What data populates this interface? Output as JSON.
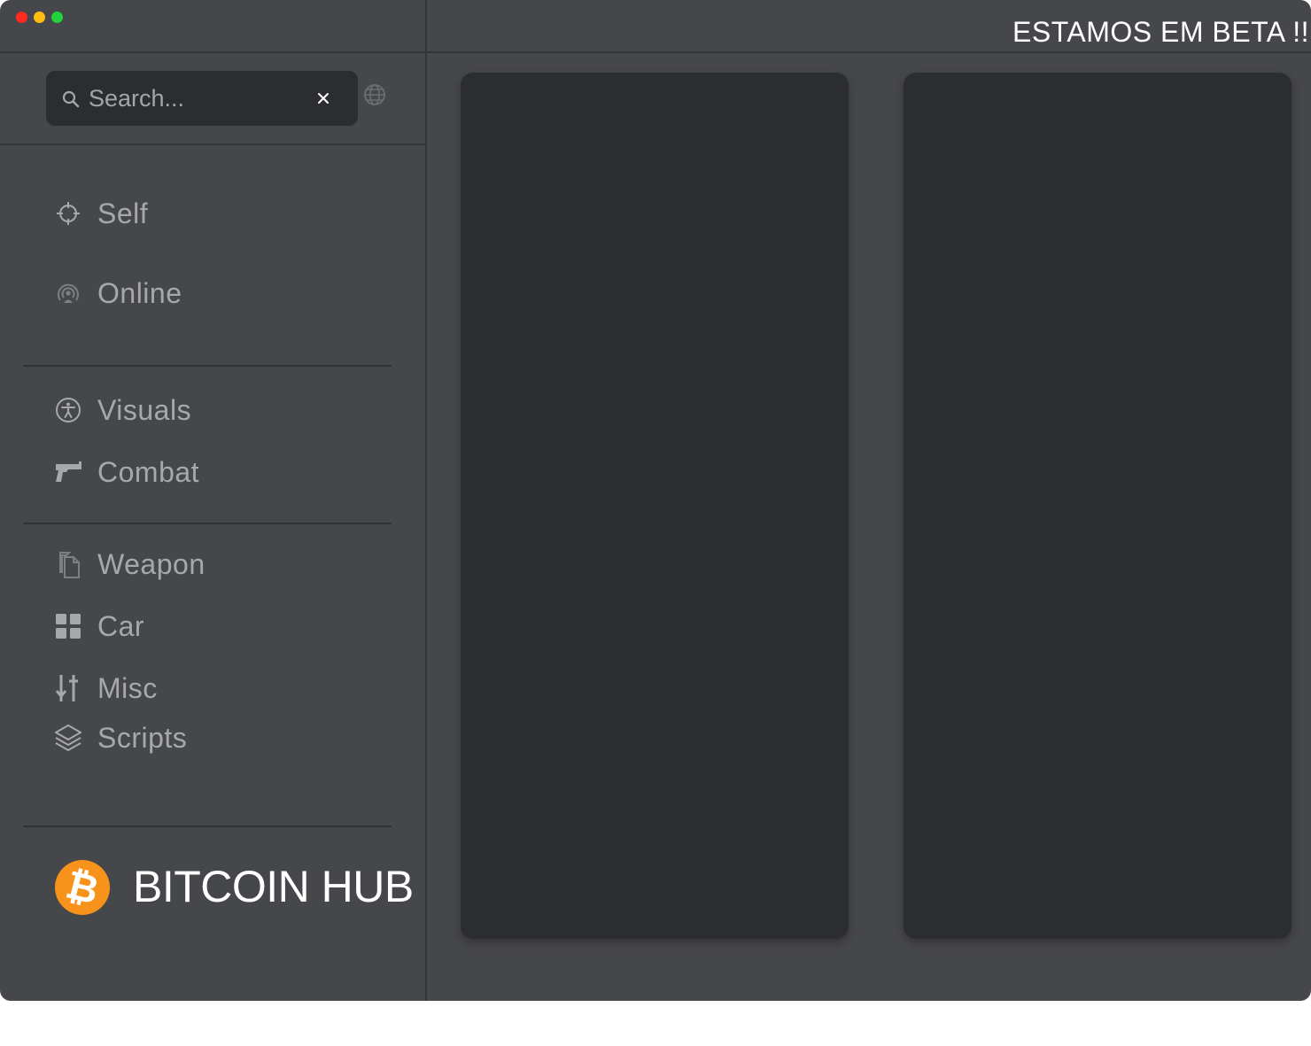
{
  "titlebar": {
    "banner": "ESTAMOS EM BETA !!"
  },
  "search": {
    "placeholder": "Search..."
  },
  "sidebar": {
    "items": [
      {
        "label": "Self",
        "icon": "crosshair-icon"
      },
      {
        "label": "Online",
        "icon": "broadcast-icon"
      },
      {
        "label": "Visuals",
        "icon": "accessibility-icon"
      },
      {
        "label": "Combat",
        "icon": "pistol-icon"
      },
      {
        "label": "Weapon",
        "icon": "copy-icon"
      },
      {
        "label": "Car",
        "icon": "grid-icon"
      },
      {
        "label": "Misc",
        "icon": "sliders-icon"
      },
      {
        "label": "Scripts",
        "icon": "layers-icon"
      }
    ]
  },
  "brand": {
    "name": "BITCOIN HUB",
    "logo_icon": "bitcoin-icon"
  },
  "colors": {
    "window_bg": "#46474a",
    "panel_bg": "#2c2d30",
    "text_muted": "#a6a8ac",
    "bitcoin_orange": "#f7931a",
    "traffic_red": "#ff2a20",
    "traffic_yellow": "#ffbd12",
    "traffic_green": "#22d23a"
  }
}
